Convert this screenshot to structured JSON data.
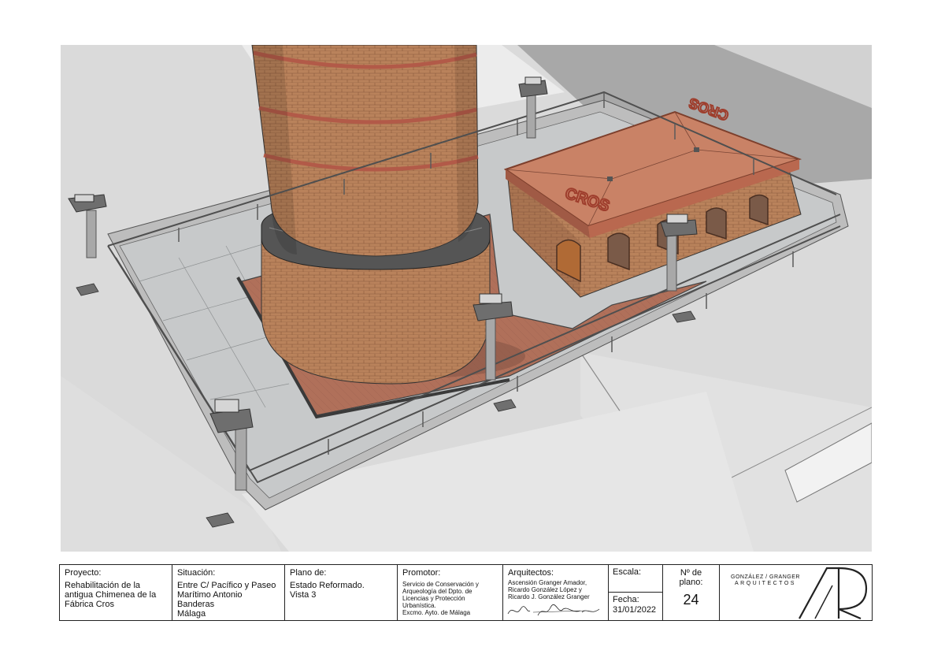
{
  "drawing": {
    "sign_text": "CROS",
    "colors": {
      "brick": "#b9825b",
      "roof": "#c98266",
      "floor": "#b0705a",
      "ground": "#dadada",
      "shadow": "#9a9a9a",
      "glass": "#b8bcbd"
    }
  },
  "titleblock": {
    "proyecto_label": "Proyecto:",
    "proyecto_value": "Rehabilitación de la\nantigua Chimenea de la\nFábrica Cros",
    "situacion_label": "Situación:",
    "situacion_value": "Entre C/ Pacífico y Paseo\nMarítimo Antonio\nBanderas\nMálaga",
    "plano_label": "Plano de:",
    "plano_value": "Estado Reformado.\nVista 3",
    "promotor_label": "Promotor:",
    "promotor_value": "Servicio de Conservación y\nArqueología del Dpto. de\nLicencias y Protección\nUrbanística.\nExcmo. Ayto. de Málaga",
    "arquitectos_label": "Arquitectos:",
    "arquitectos_value": "Ascensión Granger Amador,\nRicardo González López y\nRicardo J. González Granger",
    "escala_label": "Escala:",
    "escala_value": "",
    "fecha_label": "Fecha:",
    "fecha_value": "31/01/2022",
    "nplano_label": "Nº de plano:",
    "nplano_value": "24",
    "firm_line1": "GONZÁLEZ / GRANGER",
    "firm_line2": "ARQUITECTOS"
  }
}
